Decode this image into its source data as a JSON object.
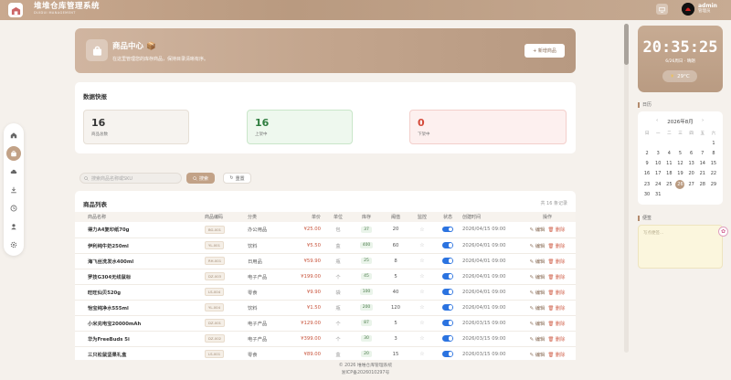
{
  "header": {
    "title": "堆堆仓库管理系统",
    "subtitle": "DUIDUI MANAGEMENT",
    "user_name": "admin",
    "user_role": "管理员",
    "icons": [
      "warehouse-icon",
      "screen-icon"
    ]
  },
  "sidebar": {
    "items": [
      {
        "name": "home",
        "icon": "home-icon"
      },
      {
        "name": "products",
        "icon": "bag-icon",
        "active": true
      },
      {
        "name": "inbound",
        "icon": "cloud-upload-icon"
      },
      {
        "name": "outbound",
        "icon": "download-icon"
      },
      {
        "name": "history",
        "icon": "clock-icon"
      },
      {
        "name": "users",
        "icon": "user-icon"
      },
      {
        "name": "settings",
        "icon": "gear-icon"
      }
    ]
  },
  "banner": {
    "title": "商品中心 📦",
    "subtitle": "在这里管理您的库存商品，保持目录清晰有序。",
    "add_button": "+ 新增商品"
  },
  "quick": {
    "title": "数据快报",
    "stats": [
      {
        "value": "16",
        "label": "商品总数",
        "color": "#333333",
        "bg": "#f6f3ef",
        "border": "#e6dfd6"
      },
      {
        "value": "16",
        "label": "上架中",
        "color": "#2f7d3f",
        "bg": "#eef8ee",
        "border": "#c9e6c9"
      },
      {
        "value": "0",
        "label": "下架中",
        "color": "#d44a3a",
        "bg": "#fdf0ef",
        "border": "#f3cfcb"
      }
    ]
  },
  "search": {
    "placeholder": "搜索商品名称或SKU",
    "search_button": "搜索",
    "reset_button": "重置"
  },
  "list": {
    "title": "商品列表",
    "count": "共 16 条记录",
    "columns": [
      "商品名称",
      "商品编码",
      "分类",
      "单价",
      "单位",
      "库存",
      "阈值",
      "监控",
      "状态",
      "创建时间",
      "操作"
    ],
    "edit_label": "编辑",
    "delete_label": "删除",
    "rows": [
      {
        "name": "得力A4复印纸70g",
        "code": "BG-001",
        "cat": "办公用品",
        "price": "¥25.00",
        "unit": "包",
        "stock": "37",
        "thr": "20",
        "time": "2026/04/15 09:00"
      },
      {
        "name": "伊利纯牛奶250ml",
        "code": "YL-001",
        "cat": "饮料",
        "price": "¥5.50",
        "unit": "盒",
        "stock": "400",
        "thr": "60",
        "time": "2026/04/01 09:00"
      },
      {
        "name": "海飞丝洗发水400ml",
        "code": "RH-001",
        "cat": "日用品",
        "price": "¥59.90",
        "unit": "瓶",
        "stock": "25",
        "thr": "8",
        "time": "2026/04/01 09:00"
      },
      {
        "name": "罗技G304无线鼠标",
        "code": "DZ-003",
        "cat": "电子产品",
        "price": "¥199.00",
        "unit": "个",
        "stock": "45",
        "thr": "5",
        "time": "2026/04/01 09:00"
      },
      {
        "name": "旺旺仙贝520g",
        "code": "LS-004",
        "cat": "零食",
        "price": "¥9.90",
        "unit": "袋",
        "stock": "100",
        "thr": "40",
        "time": "2026/04/01 09:00"
      },
      {
        "name": "怡宝纯净水555ml",
        "code": "YL-004",
        "cat": "饮料",
        "price": "¥1.50",
        "unit": "瓶",
        "stock": "200",
        "thr": "120",
        "time": "2026/04/01 09:00"
      },
      {
        "name": "小米充电宝20000mAh",
        "code": "DZ-001",
        "cat": "电子产品",
        "price": "¥129.00",
        "unit": "个",
        "stock": "87",
        "thr": "5",
        "time": "2026/03/15 09:00"
      },
      {
        "name": "华为FreeBuds 5i",
        "code": "DZ-002",
        "cat": "电子产品",
        "price": "¥399.00",
        "unit": "个",
        "stock": "30",
        "thr": "3",
        "time": "2026/03/15 09:00"
      },
      {
        "name": "三只松鼠坚果礼盒",
        "code": "LS-001",
        "cat": "零食",
        "price": "¥89.00",
        "unit": "盒",
        "stock": "20",
        "thr": "15",
        "time": "2026/03/15 09:00"
      }
    ]
  },
  "clock": {
    "time": "20:35:25",
    "date": "6/26周日 · 晴朗",
    "weather": "29°C",
    "weather_icon": "sun-icon"
  },
  "calendar": {
    "section": "日历",
    "month": "2026年8月",
    "weekdays": [
      "日",
      "一",
      "二",
      "三",
      "四",
      "五",
      "六"
    ],
    "today": "26",
    "days": [
      "",
      "",
      "",
      "",
      "",
      "",
      "1",
      "2",
      "3",
      "4",
      "5",
      "6",
      "7",
      "8",
      "9",
      "10",
      "11",
      "12",
      "13",
      "14",
      "15",
      "16",
      "17",
      "18",
      "19",
      "20",
      "21",
      "22",
      "23",
      "24",
      "25",
      "26",
      "27",
      "28",
      "29",
      "30",
      "31"
    ]
  },
  "memo": {
    "section": "便签",
    "placeholder": "写点便签..."
  },
  "footer": {
    "line1": "© 2026 堆堆仓库管理系统",
    "line2": "浙ICP备2026010297号"
  }
}
